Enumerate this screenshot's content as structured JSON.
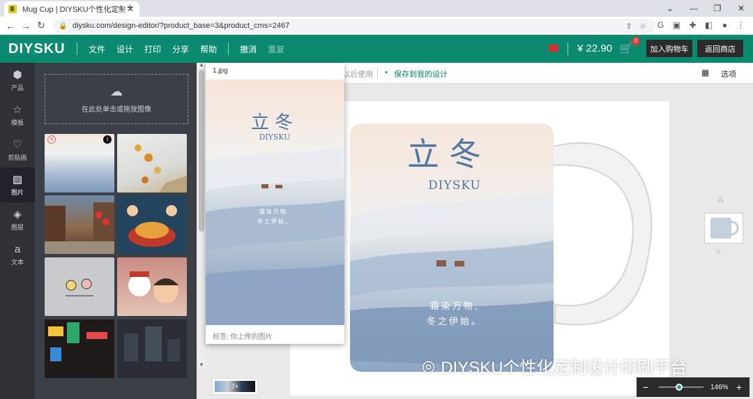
{
  "browser": {
    "tab_title": "Mug Cup | DIYSKU个性化定制设",
    "tab_close": "✕",
    "new_tab": "+",
    "win_min": "⌄",
    "win_minimize": "—",
    "win_max": "❐",
    "win_close": "✕",
    "url": "diysku.com/design-editor/?product_base=3&product_cms=2467"
  },
  "appbar": {
    "logo": "DIYSKU",
    "menus": [
      "文件",
      "设计",
      "打印",
      "分享",
      "帮助"
    ],
    "undo": "撤消",
    "redo": "重复",
    "price": "¥ 22.90",
    "cart_count": "0",
    "add_to_cart": "加入购物车",
    "back_to_shop": "返回商店"
  },
  "rail": [
    {
      "icon": "cube-icon",
      "label": "产品"
    },
    {
      "icon": "star-icon",
      "label": "模板"
    },
    {
      "icon": "heart-icon",
      "label": "剪贴画"
    },
    {
      "icon": "image-icon",
      "label": "图片"
    },
    {
      "icon": "layers-icon",
      "label": "图层"
    },
    {
      "icon": "text-icon",
      "label": "文本"
    }
  ],
  "library": {
    "upload_hint": "在此处单击或拖放图像"
  },
  "toolbar": {
    "use_later": "以后使用",
    "save_design": "保存到我的设计",
    "options": "选项"
  },
  "popup": {
    "filename": "1.jpg",
    "tags": "标签:  你上传的图片"
  },
  "artwork": {
    "title": "立冬",
    "brand": "DIYSKU",
    "line1": "霜染万物,",
    "line2": "冬之伊始。"
  },
  "swatch": {
    "label": "7+"
  },
  "zoom": {
    "minus": "−",
    "plus": "+",
    "value": "146%",
    "level": 0.45
  },
  "watermark": "DIYSKU个性化定制设计印刷平台",
  "colors": {
    "accent": "#0a8a6f",
    "rail": "#2e3237",
    "library": "#3b4046"
  }
}
